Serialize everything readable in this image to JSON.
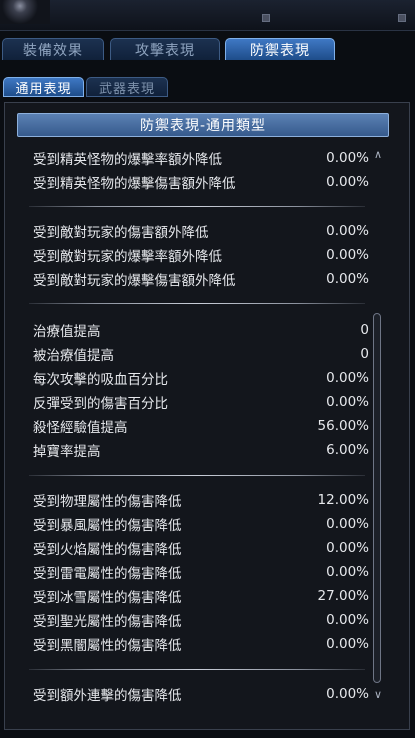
{
  "tabs": [
    {
      "label": "裝備效果",
      "active": false
    },
    {
      "label": "攻擊表現",
      "active": false
    },
    {
      "label": "防禦表現",
      "active": true
    }
  ],
  "subtabs": [
    {
      "label": "通用表現",
      "active": true
    },
    {
      "label": "武器表現",
      "active": false
    }
  ],
  "panel": {
    "title": "防禦表現-通用類型",
    "groups": [
      [
        {
          "label": "受到精英怪物的爆擊率額外降低",
          "value": "0.00%"
        },
        {
          "label": "受到精英怪物的爆擊傷害額外降低",
          "value": "0.00%"
        }
      ],
      [
        {
          "label": "受到敵對玩家的傷害額外降低",
          "value": "0.00%"
        },
        {
          "label": "受到敵對玩家的爆擊率額外降低",
          "value": "0.00%"
        },
        {
          "label": "受到敵對玩家的爆擊傷害額外降低",
          "value": "0.00%"
        }
      ],
      [
        {
          "label": "治療值提高",
          "value": "0"
        },
        {
          "label": "被治療值提高",
          "value": "0"
        },
        {
          "label": "每次攻擊的吸血百分比",
          "value": "0.00%"
        },
        {
          "label": "反彈受到的傷害百分比",
          "value": "0.00%"
        },
        {
          "label": "殺怪經驗值提高",
          "value": "56.00%"
        },
        {
          "label": "掉寶率提高",
          "value": "6.00%"
        }
      ],
      [
        {
          "label": "受到物理屬性的傷害降低",
          "value": "12.00%"
        },
        {
          "label": "受到暴風屬性的傷害降低",
          "value": "0.00%"
        },
        {
          "label": "受到火焰屬性的傷害降低",
          "value": "0.00%"
        },
        {
          "label": "受到雷電屬性的傷害降低",
          "value": "0.00%"
        },
        {
          "label": "受到冰雪屬性的傷害降低",
          "value": "27.00%"
        },
        {
          "label": "受到聖光屬性的傷害降低",
          "value": "0.00%"
        },
        {
          "label": "受到黑闇屬性的傷害降低",
          "value": "0.00%"
        }
      ],
      [
        {
          "label": "受到額外連擊的傷害降低",
          "value": "0.00%"
        }
      ]
    ]
  },
  "icons": {
    "scroll_up": "scroll-up-icon",
    "scroll_down": "scroll-down-icon"
  },
  "colors": {
    "tab_active": "#3f78c4",
    "tab_inactive": "#1c3150",
    "header": "#5b81b4"
  }
}
